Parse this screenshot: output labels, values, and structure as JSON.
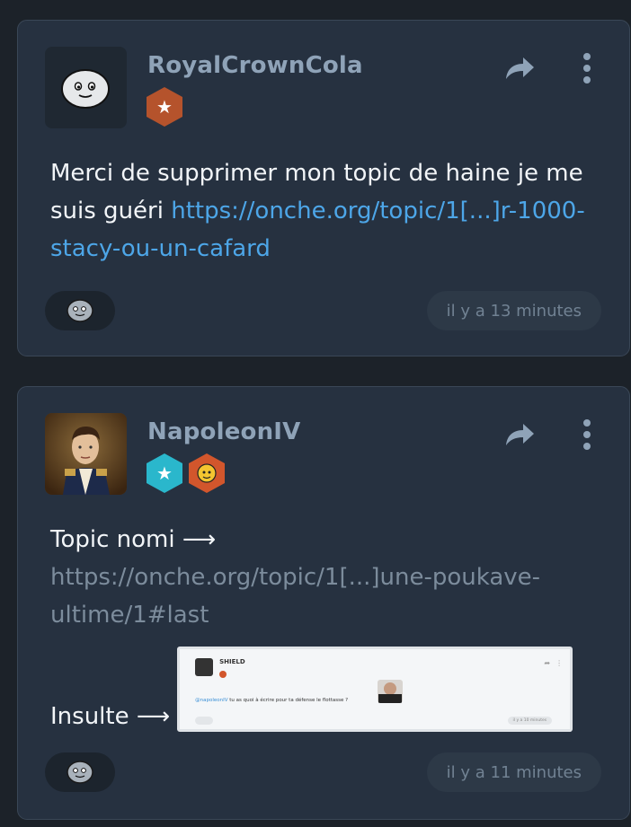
{
  "posts": [
    {
      "username": "RoyalCrownCola",
      "avatar": "onche-smiley-avatar",
      "badges": [
        "bronze-star-badge"
      ],
      "body_text": "Merci de supprimer mon topic de haine je me suis guéri ",
      "link": "https://onche.org/topic/1[...]r-1000-stacy-ou-un-cafard",
      "timestamp": "il y a 13 minutes"
    },
    {
      "username": "NapoleonIV",
      "avatar": "napoleon-portrait-avatar",
      "badges": [
        "cyan-star-badge",
        "sticker-badge"
      ],
      "line1": "Topic nomi ⟶",
      "link": "https://onche.org/topic/1[...]une-poukave-ultime/1#last",
      "line3": "Insulte ⟶",
      "embed": {
        "username": "SHIELD",
        "message_mention": "@napoleonIV",
        "message_text": " tu as quoi à écrire pour ta défense le flottasse ?",
        "timestamp": "il y a 10 minutes"
      },
      "timestamp": "il y a 11 minutes"
    }
  ],
  "colors": {
    "background": "#1c2229",
    "card": "#263140",
    "username": "#8fa3b8",
    "link_blue": "#4da6e8",
    "link_gray": "#7c8c9c"
  },
  "icons": [
    "share-arrow-icon",
    "kebab-menu-icon",
    "reaction-smiley-icon"
  ]
}
